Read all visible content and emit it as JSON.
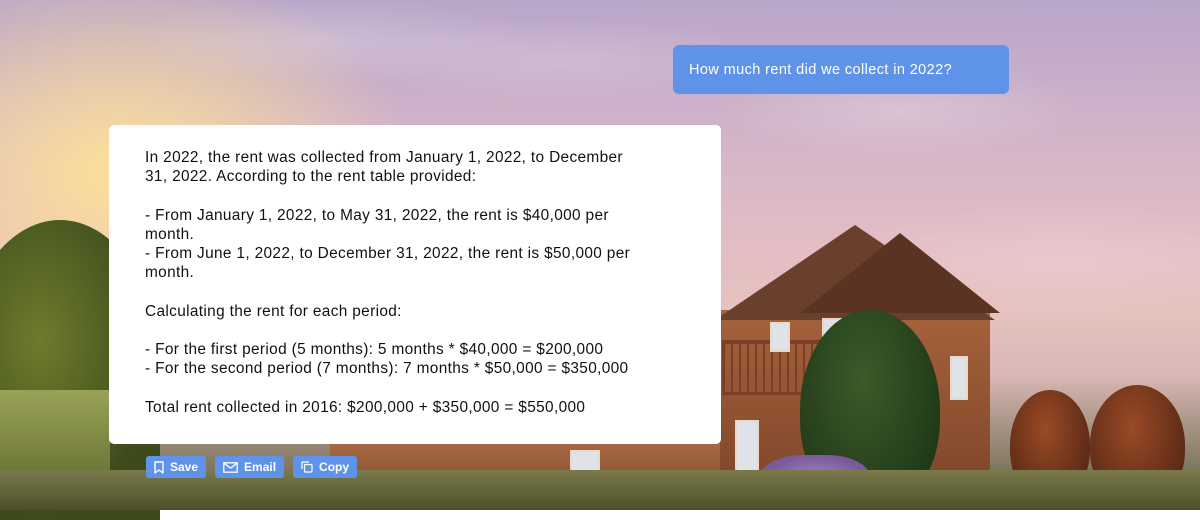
{
  "chat": {
    "user_message": "How much rent did we collect in 2022?",
    "assistant_message": "In 2022, the rent was collected from January 1, 2022, to December\n31, 2022. According to the rent table provided:\n\n- From January 1, 2022, to May 31, 2022, the rent is $40,000 per\nmonth.\n- From June 1, 2022, to December 31, 2022, the rent is $50,000 per\nmonth.\n\nCalculating the rent for each period:\n\n- For the first period (5 months): 5 months * $40,000 = $200,000\n- For the second period (7 months): 7 months * $50,000 = $350,000\n\nTotal rent collected in 2016: $200,000 + $350,000 = $550,000"
  },
  "actions": {
    "save_label": "Save",
    "email_label": "Email",
    "copy_label": "Copy"
  },
  "icons": {
    "save": "bookmark-icon",
    "email": "envelope-icon",
    "copy": "copy-icon"
  },
  "colors": {
    "accent": "#5f93ea",
    "card": "#ffffff"
  }
}
